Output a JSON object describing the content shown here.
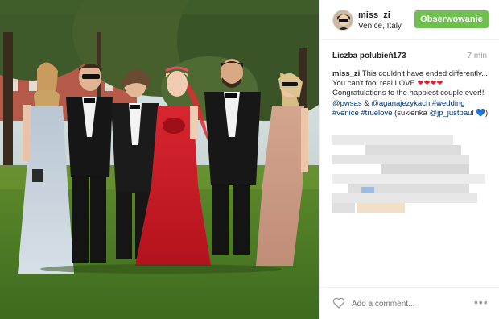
{
  "post": {
    "username": "miss_zi",
    "location": "Venice, Italy",
    "follow_label": "Obserwowanie",
    "likes_label": "Liczba polubień:",
    "likes_count": "173",
    "time_ago": "7 min",
    "caption": {
      "author": "miss_zi",
      "text_1": "This couldn't have ended differently... You can't fool real LOVE",
      "hearts": "❤❤❤❤",
      "text_2": "Congratulations to the happiest couple ever!!",
      "mention_1": "@pwsas",
      "amp": "&",
      "mention_2": "@aganajezykach",
      "tag_1": "#wedding",
      "tag_2": "#venice",
      "tag_3": "#truelove",
      "text_3": "(sukienka",
      "mention_3": "@jp_justpaul",
      "heart_blue": "💙",
      "close": ")"
    },
    "add_comment_placeholder": "Add a comment...",
    "more_label": "•••"
  },
  "icons": {
    "like": "heart-outline-icon",
    "more": "more-options-icon"
  },
  "colors": {
    "follow_button": "#70c050",
    "link": "#003569",
    "heart": "#e0202a"
  }
}
